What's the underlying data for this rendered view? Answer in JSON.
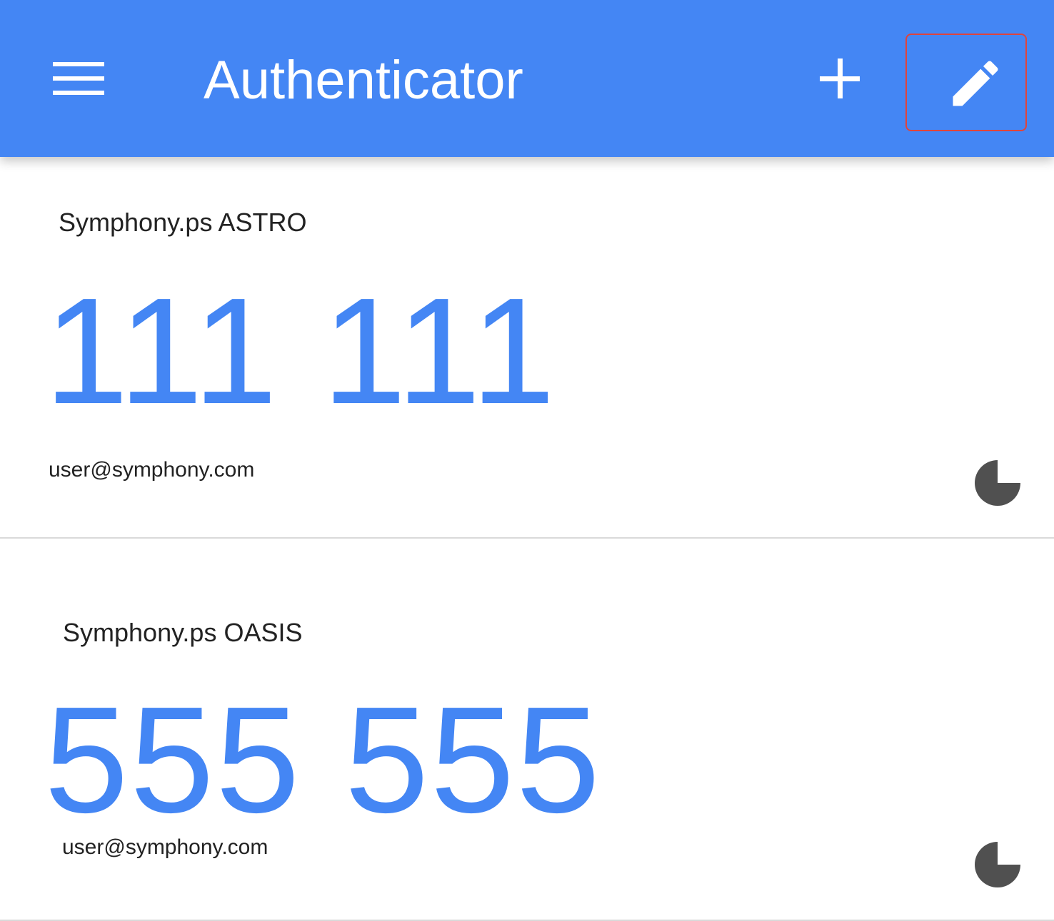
{
  "appbar": {
    "title": "Authenticator",
    "menu_icon": "menu-icon",
    "add_icon": "add-icon",
    "edit_icon": "pencil-icon",
    "background": "#4486f4",
    "highlight_border": "#e0443c"
  },
  "accounts": [
    {
      "issuer": "Symphony.ps ASTRO",
      "code": "111 111",
      "user": "user@symphony.com",
      "timer_icon": "countdown-pie-icon"
    },
    {
      "issuer": "Symphony.ps OASIS",
      "code": "555 555",
      "user": "user@symphony.com",
      "timer_icon": "countdown-pie-icon"
    }
  ],
  "colors": {
    "code": "#4486f4",
    "text": "#222222",
    "timer": "#505050",
    "divider": "#dadada"
  }
}
